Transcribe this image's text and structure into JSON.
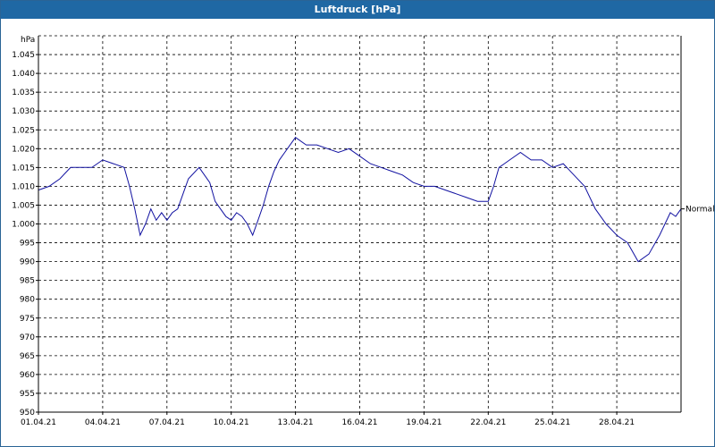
{
  "window": {
    "title": "Luftdruck [hPa]"
  },
  "chart_data": {
    "type": "line",
    "title": "Luftdruck [hPa]",
    "ylabel": "hPa",
    "xlabel": "",
    "ylim": [
      950,
      1050
    ],
    "xlim": [
      "01.04.21",
      "01.05.21"
    ],
    "y_ticks": [
      950,
      955,
      960,
      965,
      970,
      975,
      980,
      985,
      990,
      995,
      1000,
      1005,
      1010,
      1015,
      1020,
      1025,
      1030,
      1035,
      1040,
      1045
    ],
    "y_tick_labels": [
      "950",
      "955",
      "960",
      "965",
      "970",
      "975",
      "980",
      "985",
      "990",
      "995",
      "1.000",
      "1.005",
      "1.010",
      "1.015",
      "1.020",
      "1.025",
      "1.030",
      "1.035",
      "1.040",
      "1.045"
    ],
    "x_ticks": [
      "01.04.21",
      "04.04.21",
      "07.04.21",
      "10.04.21",
      "13.04.21",
      "16.04.21",
      "19.04.21",
      "22.04.21",
      "25.04.21",
      "28.04.21"
    ],
    "grid": true,
    "reference_line": {
      "label": "Normal",
      "value": 1004
    },
    "series": [
      {
        "color": "#1010a0",
        "points": [
          [
            "01.04.21 00:00",
            1009
          ],
          [
            "01.04.21 12:00",
            1010
          ],
          [
            "02.04.21 00:00",
            1012
          ],
          [
            "02.04.21 12:00",
            1015
          ],
          [
            "03.04.21 00:00",
            1015
          ],
          [
            "03.04.21 12:00",
            1015
          ],
          [
            "04.04.21 00:00",
            1017
          ],
          [
            "04.04.21 12:00",
            1016
          ],
          [
            "05.04.21 00:00",
            1015
          ],
          [
            "05.04.21 06:00",
            1010
          ],
          [
            "05.04.21 12:00",
            1004
          ],
          [
            "05.04.21 18:00",
            997
          ],
          [
            "06.04.21 00:00",
            1000
          ],
          [
            "06.04.21 06:00",
            1004
          ],
          [
            "06.04.21 12:00",
            1001
          ],
          [
            "06.04.21 18:00",
            1003
          ],
          [
            "07.04.21 00:00",
            1001
          ],
          [
            "07.04.21 06:00",
            1003
          ],
          [
            "07.04.21 12:00",
            1004
          ],
          [
            "07.04.21 18:00",
            1008
          ],
          [
            "08.04.21 00:00",
            1012
          ],
          [
            "08.04.21 12:00",
            1015
          ],
          [
            "09.04.21 00:00",
            1011
          ],
          [
            "09.04.21 06:00",
            1006
          ],
          [
            "09.04.21 12:00",
            1004
          ],
          [
            "09.04.21 18:00",
            1002
          ],
          [
            "10.04.21 00:00",
            1001
          ],
          [
            "10.04.21 06:00",
            1003
          ],
          [
            "10.04.21 12:00",
            1002
          ],
          [
            "10.04.21 18:00",
            1000
          ],
          [
            "11.04.21 00:00",
            997
          ],
          [
            "11.04.21 06:00",
            1001
          ],
          [
            "11.04.21 12:00",
            1005
          ],
          [
            "11.04.21 18:00",
            1010
          ],
          [
            "12.04.21 00:00",
            1014
          ],
          [
            "12.04.21 06:00",
            1017
          ],
          [
            "12.04.21 12:00",
            1019
          ],
          [
            "12.04.21 18:00",
            1021
          ],
          [
            "13.04.21 00:00",
            1023
          ],
          [
            "13.04.21 12:00",
            1021
          ],
          [
            "14.04.21 00:00",
            1021
          ],
          [
            "14.04.21 12:00",
            1020
          ],
          [
            "15.04.21 00:00",
            1019
          ],
          [
            "15.04.21 12:00",
            1020
          ],
          [
            "16.04.21 00:00",
            1018
          ],
          [
            "16.04.21 12:00",
            1016
          ],
          [
            "17.04.21 00:00",
            1015
          ],
          [
            "17.04.21 12:00",
            1014
          ],
          [
            "18.04.21 00:00",
            1013
          ],
          [
            "18.04.21 12:00",
            1011
          ],
          [
            "19.04.21 00:00",
            1010
          ],
          [
            "19.04.21 12:00",
            1010
          ],
          [
            "20.04.21 00:00",
            1009
          ],
          [
            "20.04.21 12:00",
            1008
          ],
          [
            "21.04.21 00:00",
            1007
          ],
          [
            "21.04.21 12:00",
            1006
          ],
          [
            "22.04.21 00:00",
            1006
          ],
          [
            "22.04.21 06:00",
            1010
          ],
          [
            "22.04.21 12:00",
            1015
          ],
          [
            "22.04.21 18:00",
            1016
          ],
          [
            "23.04.21 00:00",
            1017
          ],
          [
            "23.04.21 12:00",
            1019
          ],
          [
            "24.04.21 00:00",
            1017
          ],
          [
            "24.04.21 12:00",
            1017
          ],
          [
            "25.04.21 00:00",
            1015
          ],
          [
            "25.04.21 12:00",
            1016
          ],
          [
            "26.04.21 00:00",
            1013
          ],
          [
            "26.04.21 12:00",
            1010
          ],
          [
            "27.04.21 00:00",
            1004
          ],
          [
            "27.04.21 12:00",
            1000
          ],
          [
            "28.04.21 00:00",
            997
          ],
          [
            "28.04.21 12:00",
            995
          ],
          [
            "29.04.21 00:00",
            990
          ],
          [
            "29.04.21 12:00",
            992
          ],
          [
            "30.04.21 00:00",
            997
          ],
          [
            "30.04.21 06:00",
            1000
          ],
          [
            "30.04.21 12:00",
            1003
          ],
          [
            "30.04.21 18:00",
            1002
          ],
          [
            "01.05.21 00:00",
            1004
          ]
        ]
      }
    ]
  }
}
